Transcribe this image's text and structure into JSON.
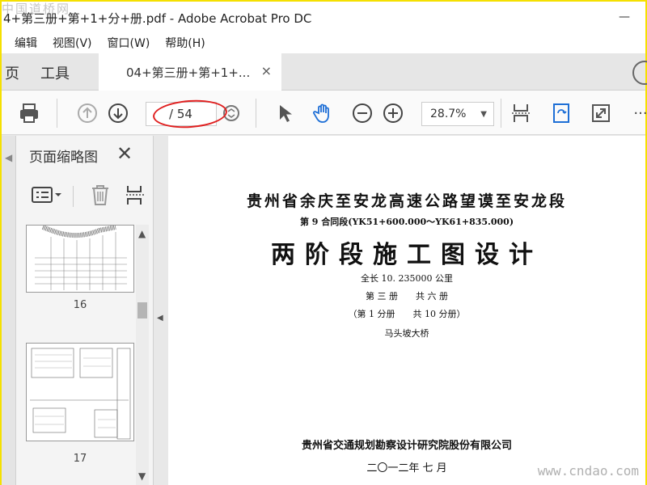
{
  "window": {
    "title": "4+第三册+第+1+分+册.pdf - Adobe Acrobat Pro DC",
    "watermark_top": "中国道桥网",
    "watermark_bottom": "www.cndao.com"
  },
  "menu": [
    "编辑",
    "视图(V)",
    "窗口(W)",
    "帮助(H)"
  ],
  "tabs": {
    "home": "页",
    "tools": "工具",
    "document": "04+第三册+第+1+...",
    "close": "×"
  },
  "toolbar": {
    "current_page": "",
    "total_pages": "/ 54",
    "zoom": "28.7%",
    "more": "···"
  },
  "panel": {
    "title": "页面缩略图",
    "close": "✕",
    "thumbnails": [
      {
        "label": "16"
      },
      {
        "label": "17"
      }
    ]
  },
  "document": {
    "line1": "贵州省余庆至安龙高速公路望谟至安龙段",
    "line2": "第 9 合同段(YK51+600.000～YK61+835.000)",
    "line3": "两阶段施工图设计",
    "line4": "全长 10. 235000 公里",
    "line5": "第 三 册　　共 六 册",
    "line6": "（第 1 分册　　共 10 分册）",
    "line7": "马头坡大桥",
    "line8": "贵州省交通规划勘察设计研究院股份有限公司",
    "line9": "二〇一二年 七 月"
  }
}
